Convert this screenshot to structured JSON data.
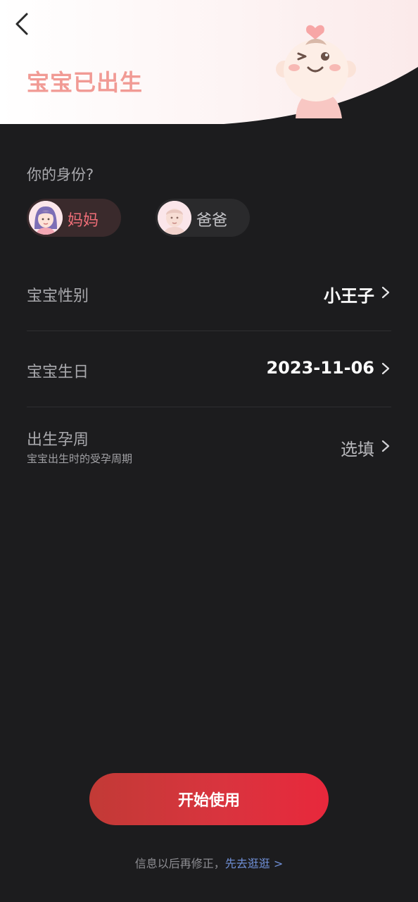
{
  "header": {
    "title": "宝宝已出生",
    "back_icon": "chevron-left-icon",
    "illustration": "baby-wink-illustration",
    "bg_color": "#fdf1f1"
  },
  "identity": {
    "question": "你的身份?",
    "options": [
      {
        "label": "妈妈",
        "selected": true,
        "avatar": "mom-avatar"
      },
      {
        "label": "爸爸",
        "selected": false,
        "avatar": "dad-avatar"
      }
    ]
  },
  "form": {
    "gender": {
      "label": "宝宝性别",
      "value": "小王子"
    },
    "birthday": {
      "label": "宝宝生日",
      "value": "2023-11-06"
    },
    "gestation": {
      "label": "出生孕周",
      "sublabel": "宝宝出生时的受孕周期",
      "value": "选填"
    }
  },
  "actions": {
    "start_label": "开始使用",
    "note": "信息以后再修正，",
    "skip_link": "先去逛逛 >"
  },
  "colors": {
    "accent": "#e8283c",
    "title_pink": "#f19a94",
    "link_blue": "#6f8fd6",
    "background": "#1c1c1e"
  }
}
